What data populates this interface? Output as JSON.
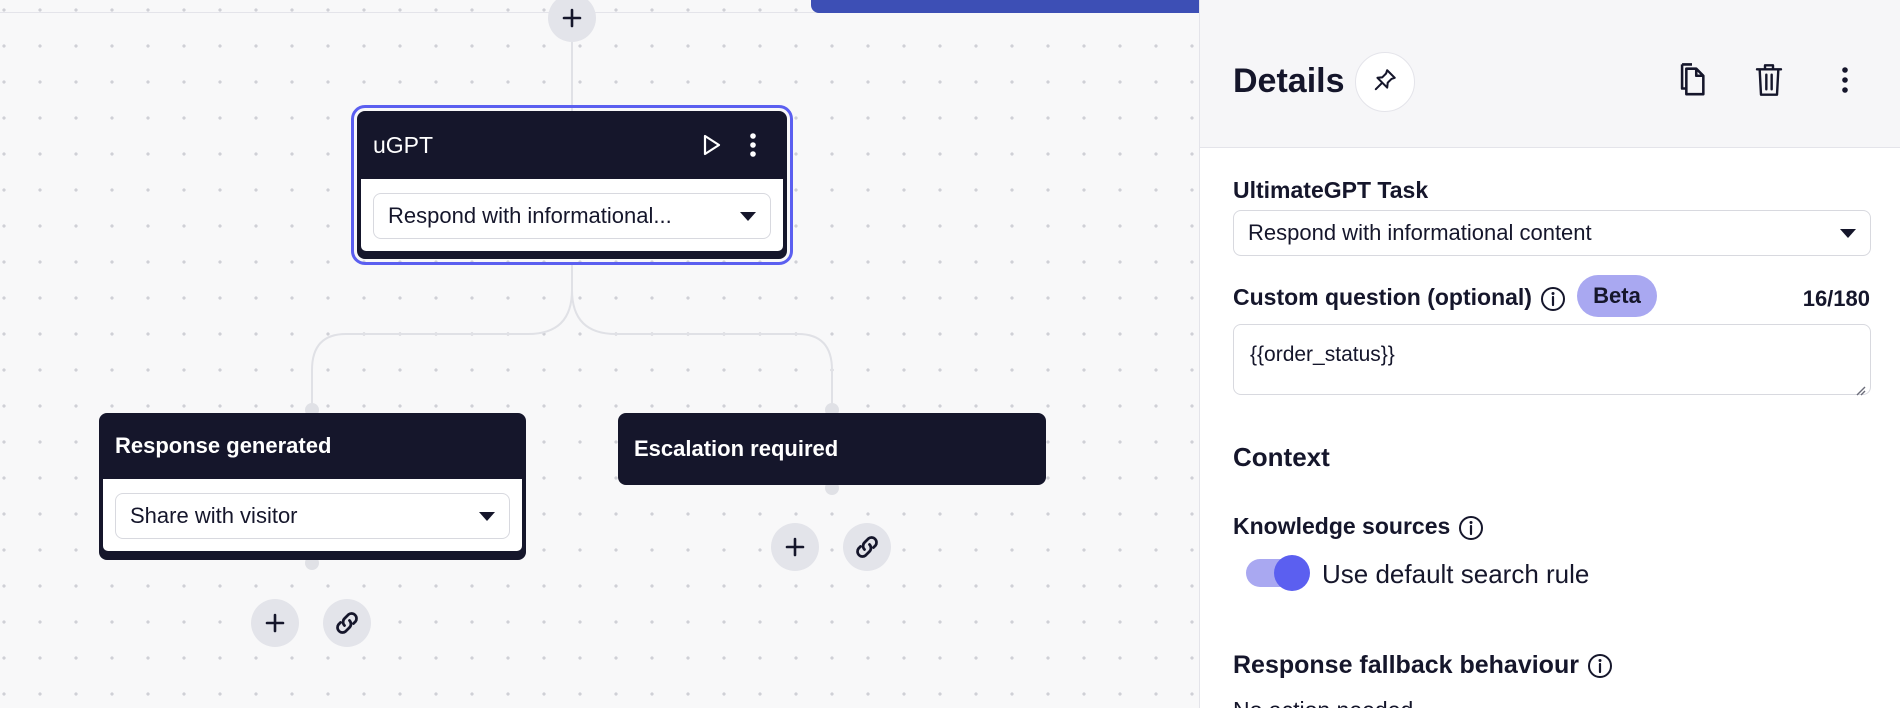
{
  "canvas": {
    "nodes": {
      "ugpt": {
        "title": "uGPT",
        "select_value": "Respond with informational..."
      },
      "response": {
        "title": "Response generated",
        "select_value": "Share with visitor"
      },
      "escalation": {
        "title": "Escalation required"
      }
    }
  },
  "details": {
    "title": "Details",
    "task_label": "UltimateGPT Task",
    "task_value": "Respond with informational content",
    "custom_question_label": "Custom question (optional)",
    "beta_badge": "Beta",
    "char_count": "16/180",
    "custom_question_value": "{{order_status}}",
    "context_title": "Context",
    "knowledge_label": "Knowledge sources",
    "toggle_label": "Use default search rule",
    "toggle_on": true,
    "fallback_label": "Response fallback behaviour",
    "fallback_partial": "No action needed"
  },
  "colors": {
    "node_bg": "#15162b",
    "accent": "#5b5ff0",
    "accent_soft": "#a9a8f1",
    "top_tab": "#3d4fb5"
  },
  "icons": [
    "plus-icon",
    "link-icon",
    "play-icon",
    "more-vertical-icon",
    "pin-icon",
    "copy-icon",
    "trash-icon",
    "info-icon",
    "caret-down-icon"
  ]
}
